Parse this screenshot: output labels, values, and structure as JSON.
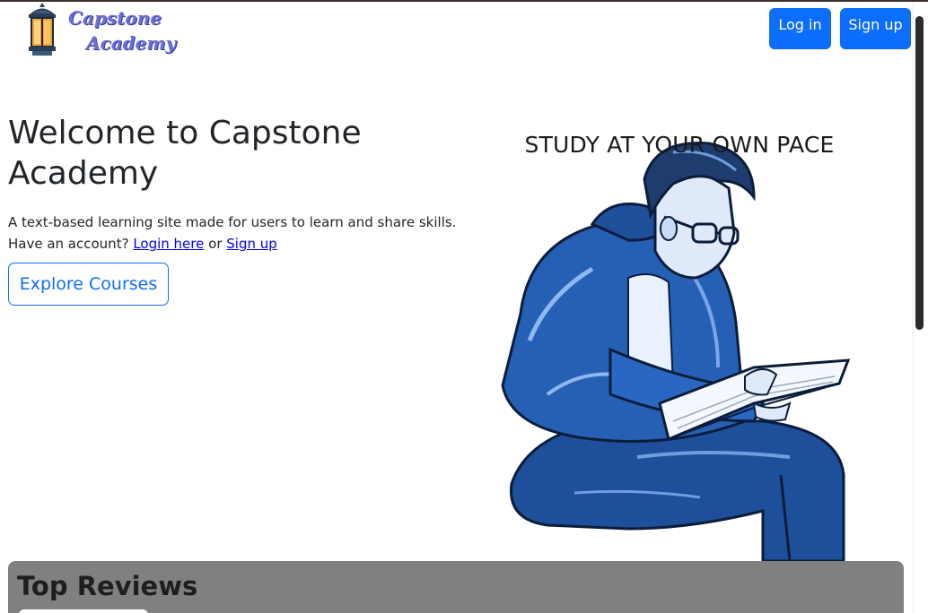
{
  "header": {
    "logo_line1": "Capstone",
    "logo_line2": "Academy",
    "login_label": "Log in",
    "signup_label": "Sign up"
  },
  "hero": {
    "title": "Welcome to Capstone Academy",
    "description": "A text-based learning site made for users to learn and share skills.",
    "account_prompt": "Have an account?",
    "login_link": "Login here",
    "or_text": "or",
    "signup_link": "Sign up",
    "explore_label": "Explore Courses",
    "study_title": "STUDY AT YOUR OWN PACE"
  },
  "reviews": {
    "title": "Top Reviews"
  },
  "colors": {
    "primary": "#0d6efd",
    "reviews_bg": "#808080",
    "logo_purple": "#6b6fd6"
  }
}
